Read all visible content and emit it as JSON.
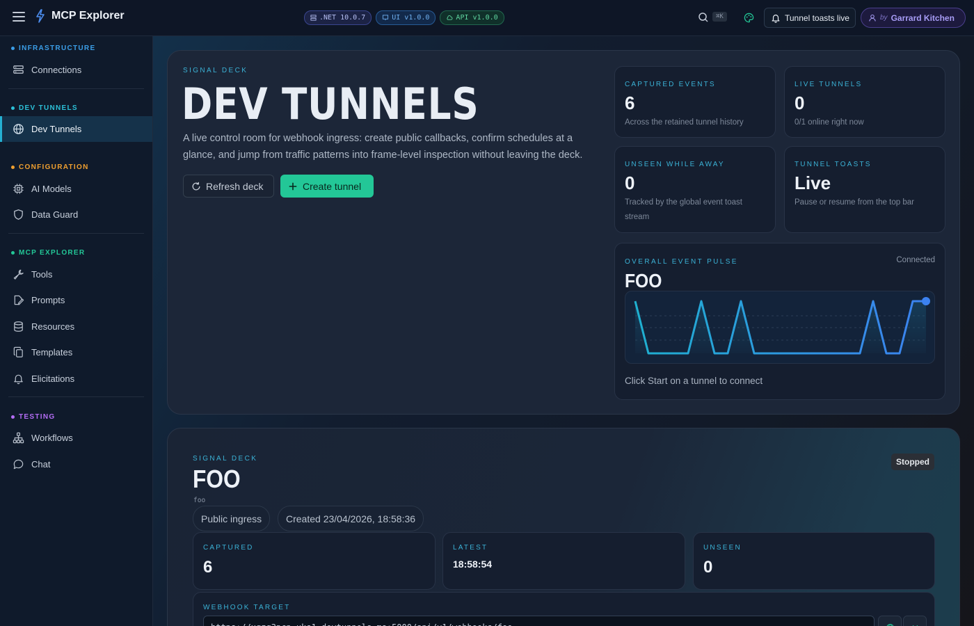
{
  "app": {
    "title": "MCP Explorer",
    "versions": [
      ".NET 10.0.7",
      "UI v1.0.0",
      "API v1.0.0"
    ],
    "shortcut": "⌘K",
    "toast_button": "Tunnel toasts live",
    "user_prefix": "by",
    "user_name": "Garrard Kitchen"
  },
  "sidebar": {
    "sections": [
      {
        "title": "INFRASTRUCTURE",
        "color": "#3b9ee8",
        "items": [
          {
            "label": "Connections",
            "icon": "server-icon"
          }
        ]
      },
      {
        "title": "DEV TUNNELS",
        "color": "#2cc0d8",
        "items": [
          {
            "label": "Dev Tunnels",
            "icon": "globe-icon",
            "active": true
          }
        ]
      },
      {
        "title": "CONFIGURATION",
        "color": "#f0a030",
        "items": [
          {
            "label": "AI Models",
            "icon": "chip-icon"
          },
          {
            "label": "Data Guard",
            "icon": "shield-icon"
          }
        ]
      },
      {
        "title": "MCP EXPLORER",
        "color": "#23c797",
        "items": [
          {
            "label": "Tools",
            "icon": "wrench-icon"
          },
          {
            "label": "Prompts",
            "icon": "document-pen-icon"
          },
          {
            "label": "Resources",
            "icon": "database-icon"
          },
          {
            "label": "Templates",
            "icon": "copy-icon"
          },
          {
            "label": "Elicitations",
            "icon": "bell-icon"
          }
        ]
      },
      {
        "title": "TESTING",
        "color": "#b46df5",
        "items": [
          {
            "label": "Workflows",
            "icon": "workflow-icon"
          },
          {
            "label": "Chat",
            "icon": "chat-icon"
          }
        ]
      }
    ]
  },
  "hero": {
    "eyebrow": "SIGNAL DECK",
    "title": "DEV TUNNELS",
    "description": "A live control room for webhook ingress: create public callbacks, confirm schedules at a glance, and jump from traffic patterns into frame-level inspection without leaving the deck.",
    "refresh_label": "Refresh deck",
    "create_label": "Create tunnel"
  },
  "stats": [
    {
      "label": "CAPTURED EVENTS",
      "value": "6",
      "sub": "Across the retained tunnel history"
    },
    {
      "label": "LIVE TUNNELS",
      "value": "0",
      "sub": "0/1 online right now"
    },
    {
      "label": "UNSEEN WHILE AWAY",
      "value": "0",
      "sub": "Tracked by the global event toast stream"
    },
    {
      "label": "TUNNEL TOASTS",
      "value": "Live",
      "sub": "Pause or resume from the top bar"
    }
  ],
  "pulse": {
    "label": "OVERALL EVENT PULSE",
    "status": "Connected",
    "name": "FOO",
    "hint": "Click Start on a tunnel to connect",
    "series": [
      1,
      0,
      0,
      0,
      0,
      1,
      0,
      0,
      1,
      0,
      0,
      0,
      0,
      0,
      0,
      0,
      0,
      0,
      1,
      0,
      0,
      1,
      1
    ],
    "line_start_color": "#1fb0d0",
    "line_end_color": "#3c82f0"
  },
  "tunnel": {
    "eyebrow": "SIGNAL DECK",
    "title": "FOO",
    "slug": "foo",
    "status": "Stopped",
    "chips": [
      "Public ingress",
      "Created 23/04/2026, 18:58:36"
    ],
    "captured_label": "CAPTURED",
    "captured_value": "6",
    "latest_label": "LATEST",
    "latest_value": "18:58:54",
    "unseen_label": "UNSEEN",
    "unseen_value": "0",
    "webhook_label": "WEBHOOK TARGET",
    "webhook_url": "https://xqzq3pcp.uks1.devtunnels.ms:5000/api/v1/webhooks/foo"
  }
}
